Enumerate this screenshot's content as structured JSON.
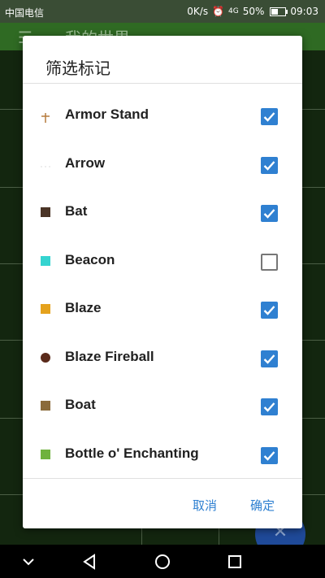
{
  "status_bar": {
    "carrier": "中国电信",
    "speed": "0K/s",
    "network": "4G",
    "battery": "50%",
    "time": "09:03"
  },
  "app_bar": {
    "title": "我的世界",
    "menu_icon": "hamburger-menu-icon"
  },
  "dialog": {
    "title": "筛选标记",
    "items": [
      {
        "label": "Armor Stand",
        "checked": true,
        "icon": "armor-stand-icon",
        "icon_color": "#b57a3c"
      },
      {
        "label": "Arrow",
        "checked": true,
        "icon": "arrow-icon",
        "icon_color": "#dddddd"
      },
      {
        "label": "Bat",
        "checked": true,
        "icon": "bat-icon",
        "icon_color": "#4a3426"
      },
      {
        "label": "Beacon",
        "checked": false,
        "icon": "beacon-icon",
        "icon_color": "#35d4d0"
      },
      {
        "label": "Blaze",
        "checked": true,
        "icon": "blaze-icon",
        "icon_color": "#e5a21d"
      },
      {
        "label": "Blaze Fireball",
        "checked": true,
        "icon": "blaze-fireball-icon",
        "icon_color": "#5a2a1a"
      },
      {
        "label": "Boat",
        "checked": true,
        "icon": "boat-icon",
        "icon_color": "#8a6a3a"
      },
      {
        "label": "Bottle o' Enchanting",
        "checked": true,
        "icon": "bottle-icon",
        "icon_color": "#6fb23d"
      }
    ],
    "cancel_label": "取消",
    "confirm_label": "确定"
  },
  "colors": {
    "accent": "#2f80d1",
    "app_bar": "#2f6a23",
    "map_background": "#13260f"
  }
}
